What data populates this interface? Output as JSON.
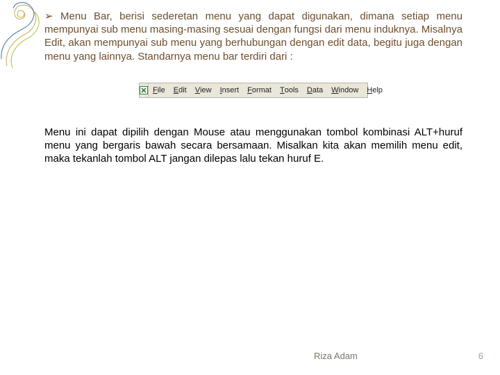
{
  "bullet_glyph": "➢",
  "para1_text": " Menu Bar, berisi sederetan menu yang dapat digunakan, dimana setiap menu mempunyai sub menu masing-masing sesuai dengan fungsi dari menu induknya. Misalnya Edit, akan mempunyai sub menu yang berhubungan dengan edit data, begitu juga dengan menu yang lainnya. Standarnya menu bar terdiri dari :",
  "menubar": {
    "items": [
      {
        "u": "F",
        "rest": "ile"
      },
      {
        "u": "E",
        "rest": "dit"
      },
      {
        "u": "V",
        "rest": "iew"
      },
      {
        "u": "I",
        "rest": "nsert"
      },
      {
        "u": "F",
        "rest": "ormat"
      },
      {
        "u": "T",
        "rest": "ools"
      },
      {
        "u": "D",
        "rest": "ata"
      },
      {
        "u": "W",
        "rest": "indow"
      },
      {
        "u": "H",
        "rest": "elp"
      }
    ]
  },
  "para2_text": "Menu ini dapat dipilih dengan Mouse atau menggunakan tombol kombinasi ALT+huruf menu yang bergaris bawah secara bersamaan. Misalkan kita akan memilih menu edit, maka tekanlah tombol ALT jangan dilepas lalu tekan huruf E.",
  "footer": {
    "author": "Riza Adam",
    "page": "6"
  }
}
